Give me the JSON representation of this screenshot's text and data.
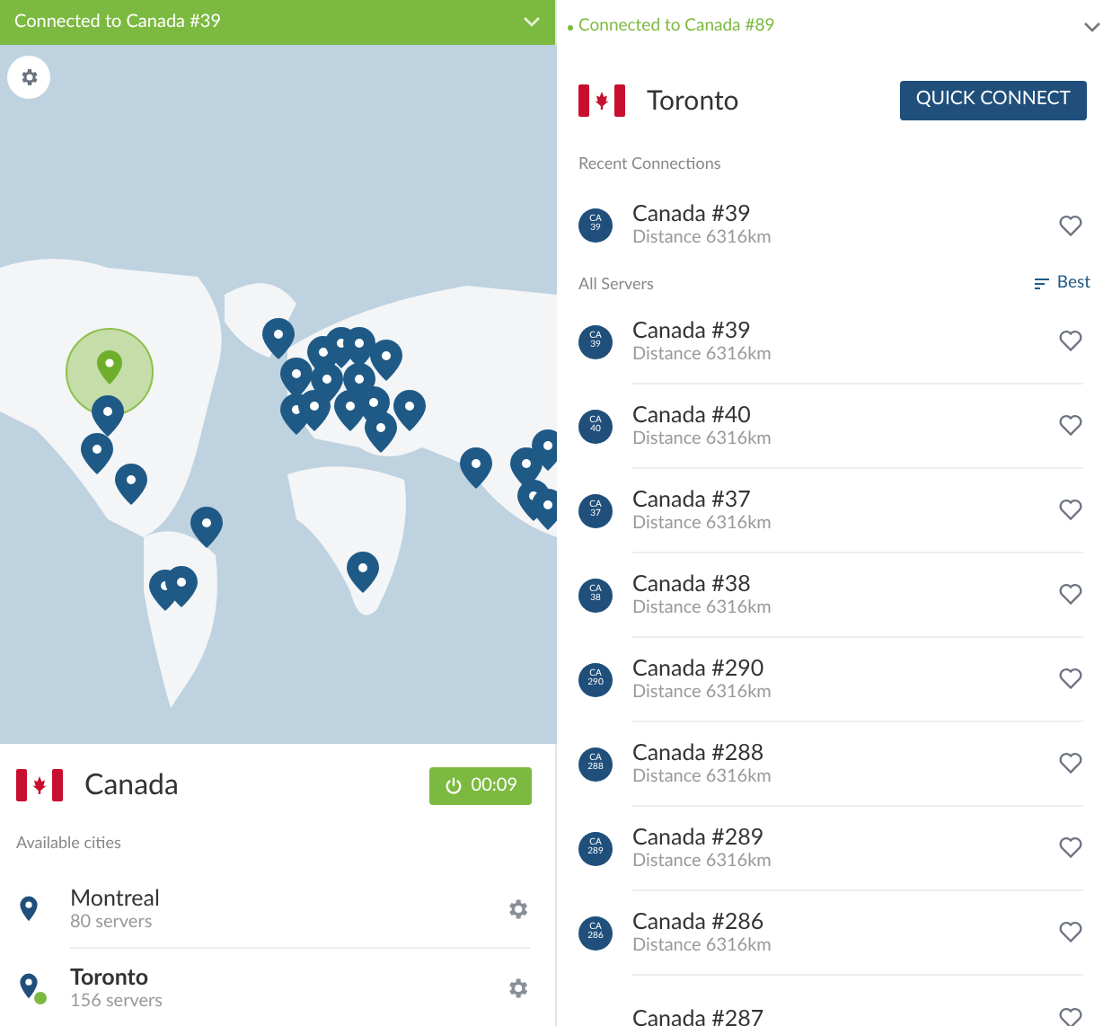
{
  "left": {
    "status_bar": {
      "text": "Connected to Canada #39",
      "connected": true
    },
    "country": {
      "name": "Canada",
      "timer": "00:09"
    },
    "cities_heading": "Available cities",
    "cities": [
      {
        "name": "Montreal",
        "servers": "80 servers",
        "connected": false
      },
      {
        "name": "Toronto",
        "servers": "156 servers",
        "connected": true
      }
    ]
  },
  "right": {
    "status_bar": {
      "text": "Connected to Canada #89",
      "connected": true
    },
    "city": "Toronto",
    "quick_connect": "QUICK CONNECT",
    "recent_heading": "Recent Connections",
    "recent": [
      {
        "name": "Canada #39",
        "distance": "Distance 6316km",
        "badge_country": "CA",
        "badge_number": "39"
      }
    ],
    "all_heading": "All Servers",
    "sort": "Best",
    "servers": [
      {
        "name": "Canada #39",
        "distance": "Distance 6316km",
        "badge_country": "CA",
        "badge_number": "39"
      },
      {
        "name": "Canada #40",
        "distance": "Distance 6316km",
        "badge_country": "CA",
        "badge_number": "40"
      },
      {
        "name": "Canada #37",
        "distance": "Distance 6316km",
        "badge_country": "CA",
        "badge_number": "37"
      },
      {
        "name": "Canada #38",
        "distance": "Distance 6316km",
        "badge_country": "CA",
        "badge_number": "38"
      },
      {
        "name": "Canada #290",
        "distance": "Distance 6316km",
        "badge_country": "CA",
        "badge_number": "290"
      },
      {
        "name": "Canada #288",
        "distance": "Distance 6316km",
        "badge_country": "CA",
        "badge_number": "288"
      },
      {
        "name": "Canada #289",
        "distance": "Distance 6316km",
        "badge_country": "CA",
        "badge_number": "289"
      },
      {
        "name": "Canada #286",
        "distance": "Distance 6316km",
        "badge_country": "CA",
        "badge_number": "286"
      },
      {
        "name": "Canada #287"
      }
    ]
  }
}
